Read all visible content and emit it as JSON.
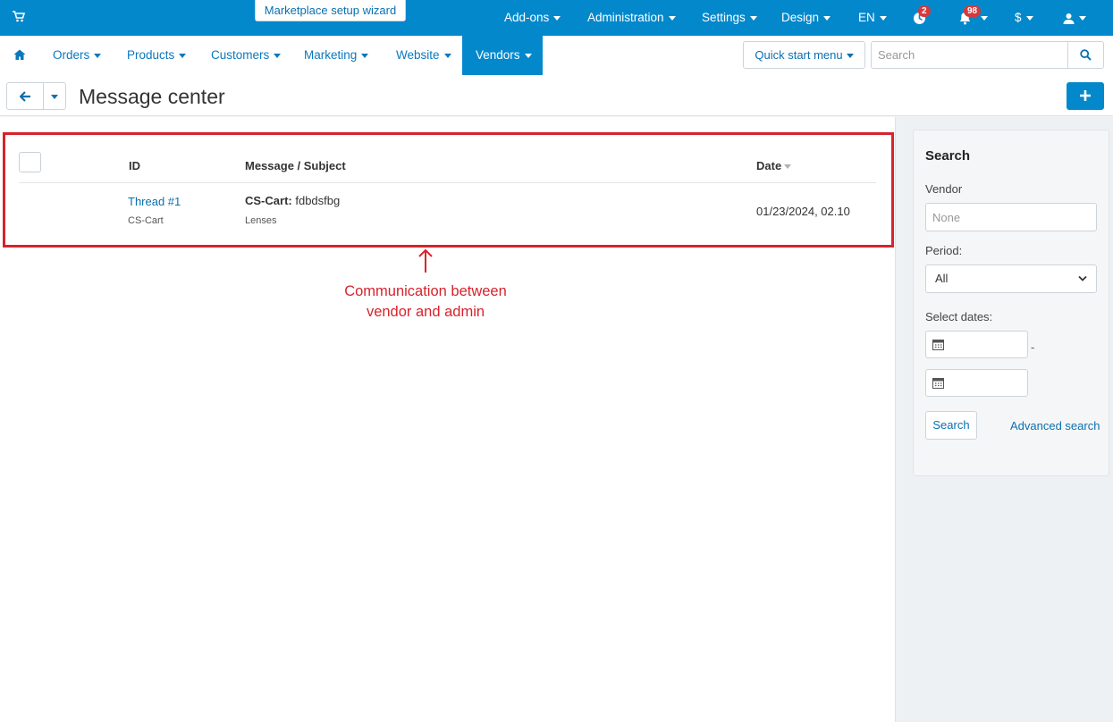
{
  "topbar": {
    "wizard_label": "Marketplace setup wizard",
    "items": [
      {
        "label": "Add-ons"
      },
      {
        "label": "Administration"
      },
      {
        "label": "Settings"
      },
      {
        "label": "Design"
      },
      {
        "label": "EN"
      }
    ],
    "updates_badge": "2",
    "notifications_badge": "98",
    "currency_label": "$",
    "bar_color": "#0388cc"
  },
  "nav": {
    "items": [
      {
        "label": "Orders"
      },
      {
        "label": "Products"
      },
      {
        "label": "Customers"
      },
      {
        "label": "Marketing"
      },
      {
        "label": "Website"
      },
      {
        "label": "Vendors",
        "active": true
      }
    ],
    "quick_start_label": "Quick start menu",
    "search_placeholder": "Search"
  },
  "page": {
    "title": "Message center"
  },
  "table": {
    "columns": {
      "id": "ID",
      "message": "Message / Subject",
      "date": "Date"
    },
    "rows": [
      {
        "thread": "Thread #1",
        "thread_owner": "CS-Cart",
        "sender": "CS-Cart:",
        "message": "fdbdsfbg",
        "subject": "Lenses",
        "date": "01/23/2024, 02.10"
      }
    ]
  },
  "annotation": {
    "text": "Communication between vendor and admin",
    "color": "#d7232c"
  },
  "sidebar": {
    "title": "Search",
    "vendor_label": "Vendor",
    "vendor_placeholder": "None",
    "period_label": "Period:",
    "period_value": "All",
    "dates_label": "Select dates:",
    "dates_separator": "-",
    "search_button": "Search",
    "advanced_search": "Advanced search"
  }
}
